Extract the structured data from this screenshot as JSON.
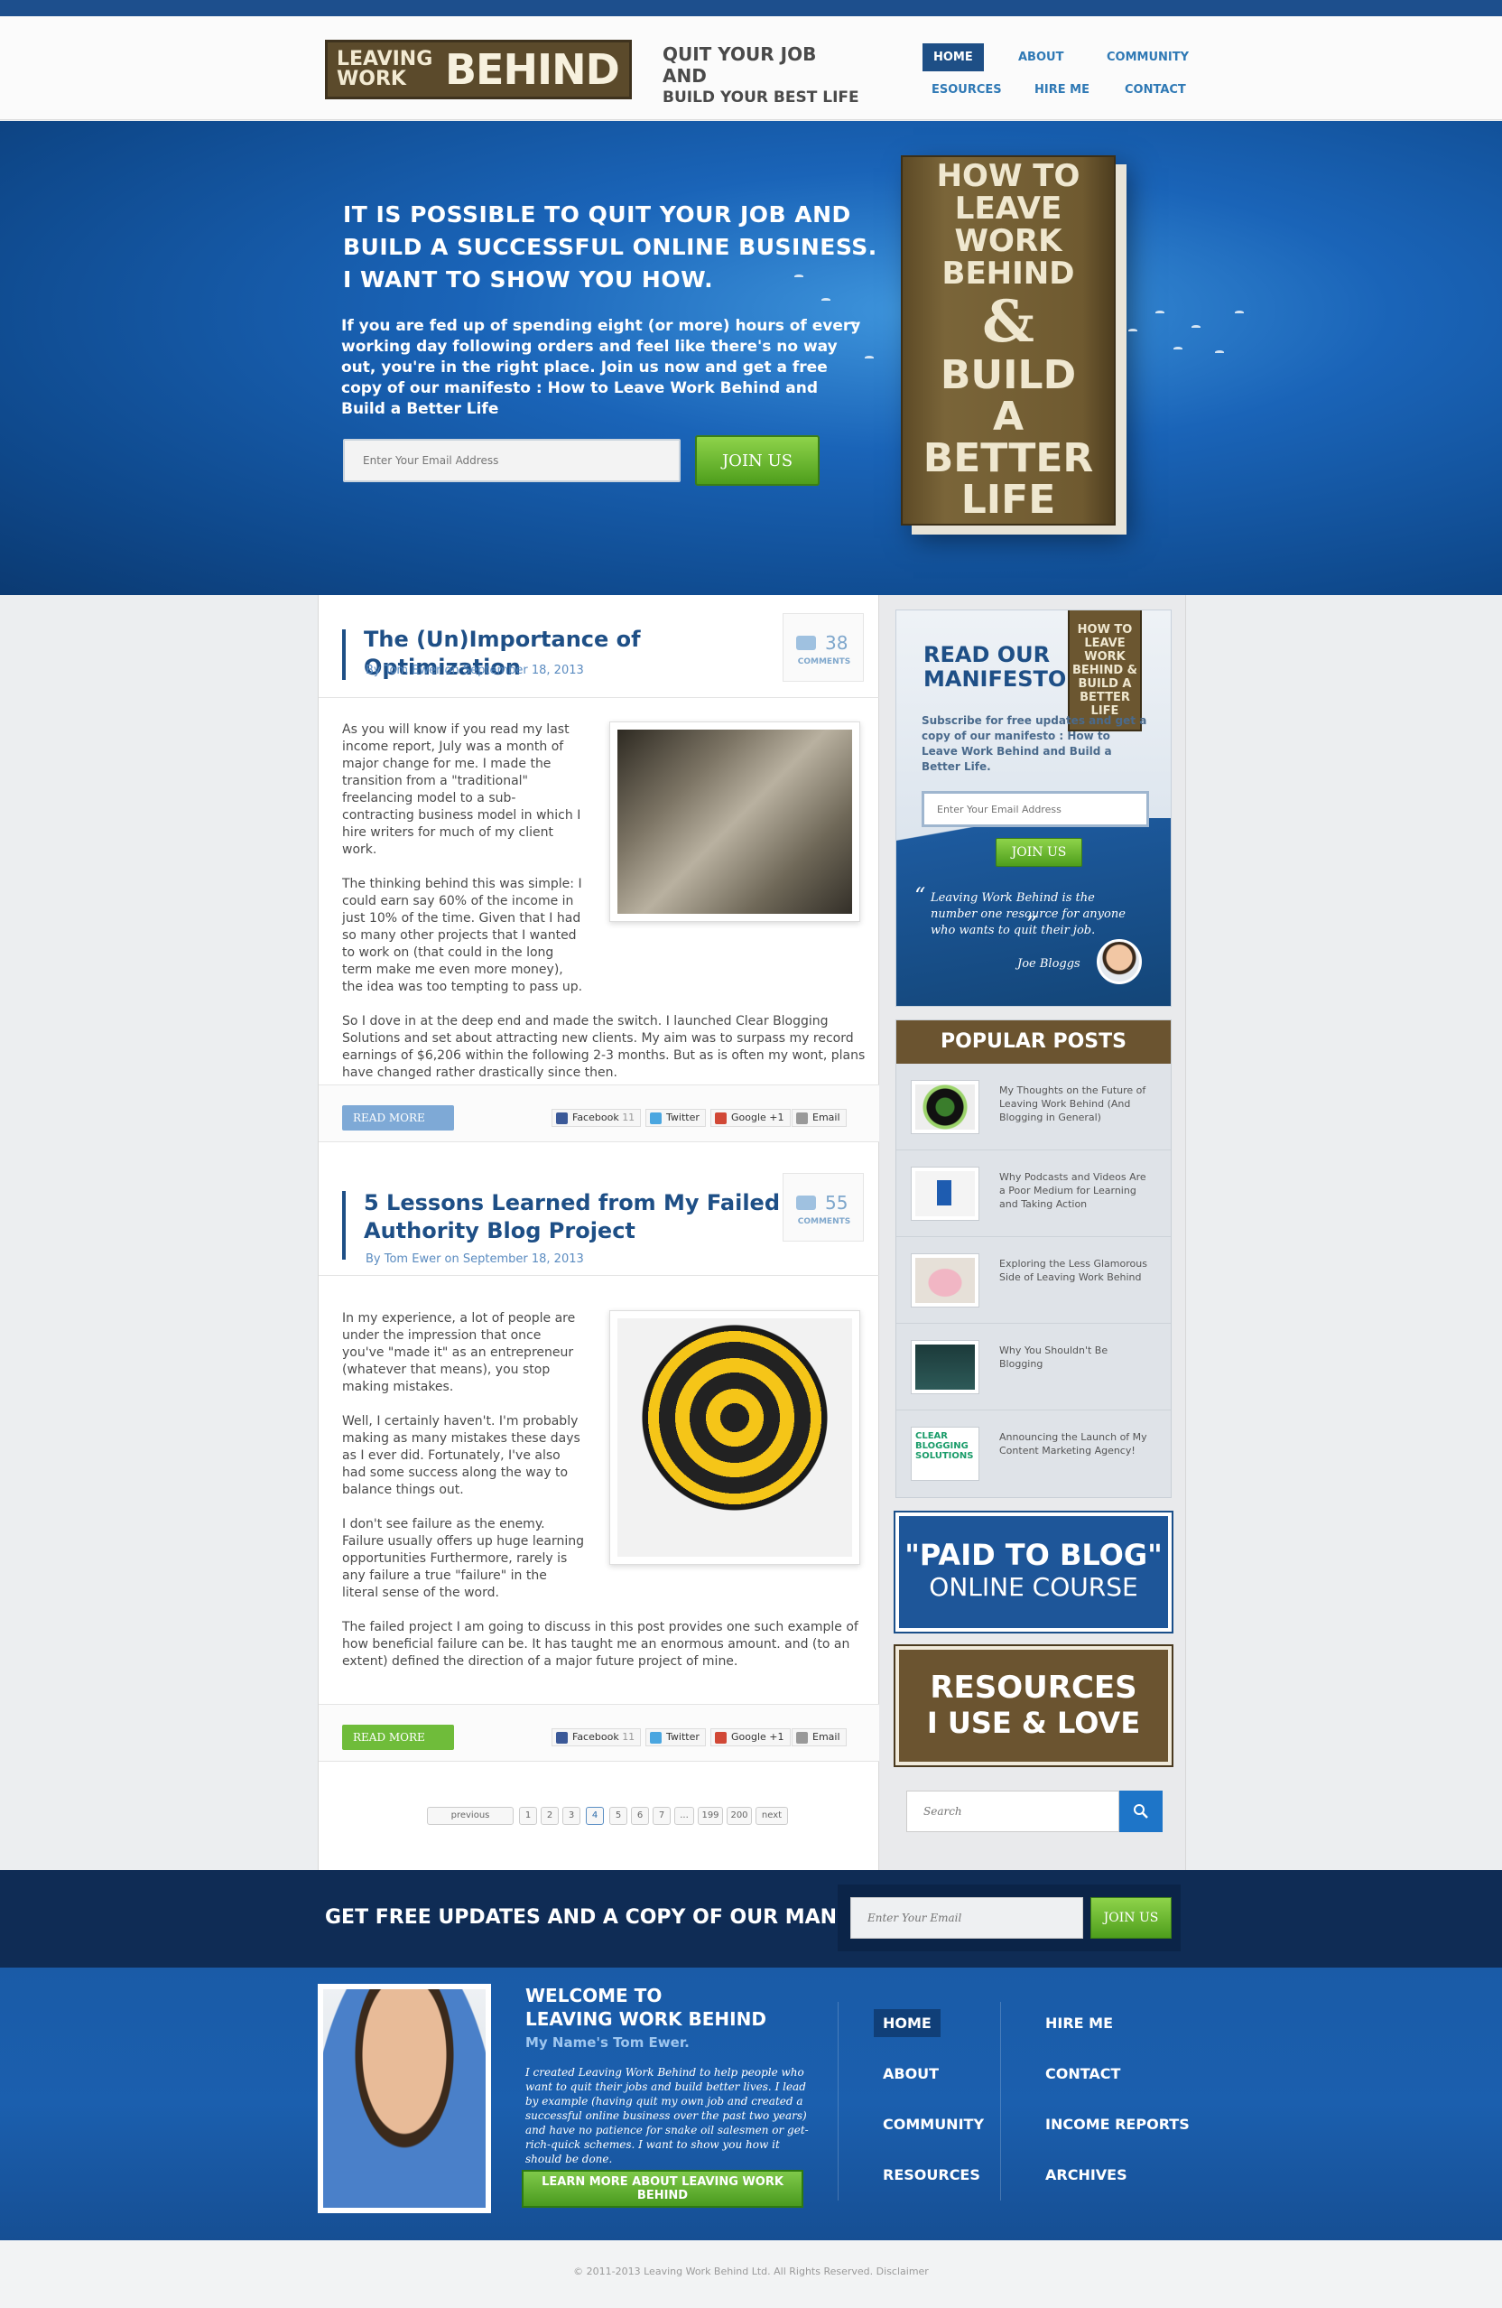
{
  "header": {
    "logo_small": "LEAVING WORK",
    "logo_big": "BEHIND",
    "tagline_l1": "QUIT YOUR JOB AND",
    "tagline_l2": "BUILD YOUR BEST LIFE",
    "nav": [
      "HOME",
      "ABOUT",
      "COMMUNITY",
      "ESOURCES",
      "HIRE ME",
      "CONTACT"
    ]
  },
  "hero": {
    "title_l1": "IT IS POSSIBLE TO QUIT YOUR JOB AND",
    "title_l2": "BUILD A SUCCESSFUL ONLINE BUSINESS.",
    "title_l3": "I WANT TO SHOW YOU HOW.",
    "text": "If you are fed up of spending eight (or more) hours of every working day following orders and feel like there's no way out, you're in the right place. Join us now and get a free copy of our manifesto : How to Leave Work Behind and Build a Better Life",
    "email_placeholder": "Enter Your Email Address",
    "join_label": "JOIN US",
    "book_l1": "HOW TO LEAVE",
    "book_l2": "WORK BEHIND",
    "book_amp": "&",
    "book_l3": "BUILD A",
    "book_l4": "BETTER LIFE"
  },
  "posts": [
    {
      "title": "The (Un)Importance of Optimization",
      "meta": "By Tom Ewer on September 18, 2013",
      "comments": "38",
      "comments_label": "COMMENTS",
      "p1": "As you will know if you read my last income report, July was a month of major change for me. I made the transition from a \"traditional\" freelancing model to a sub-contracting business model in which I hire writers for much of my client work.",
      "p2": "The thinking behind this was simple: I could earn say 60% of the income in just 10% of the time. Given that I had so many other projects that I wanted to work on (that could in the long term make me even more money), the idea was too tempting to pass up.",
      "p3": "So I dove in at the deep end and made the switch. I launched Clear Blogging Solutions and set about attracting new clients. My aim was to surpass my record earnings of $6,206 within the following 2-3 months. But as is often my wont, plans have changed rather drastically since then.",
      "read_more": "READ MORE"
    },
    {
      "title": "5 Lessons Learned from My Failed Authority Blog Project",
      "meta": "By Tom Ewer on September 18, 2013",
      "comments": "55",
      "comments_label": "COMMENTS",
      "p1": "In my experience, a lot of people are under the  impression that once you've \"made it\" as an entrepreneur (whatever that means), you stop making mistakes.",
      "p2": "Well, I certainly haven't. I'm probably making as many mistakes these days as I ever did. Fortunately, I've also had some success along the way to balance things out.",
      "p3": "I don't see failure as the enemy. Failure usually offers up huge learning opportunities Furthermore, rarely is any failure a true \"failure\" in the literal sense of the word.",
      "p4": "The failed project I am going to discuss in this post provides one such example of how beneficial failure can be. It has taught me an enormous amount. and (to an extent) defined the direction of a major future project of mine.",
      "read_more": "READ MORE"
    }
  ],
  "share": {
    "facebook": "Facebook",
    "facebook_count": "11",
    "twitter": "Twitter",
    "google": "Google +1",
    "email": "Email"
  },
  "pagination": [
    "previous",
    "1",
    "2",
    "3",
    "4",
    "5",
    "6",
    "7",
    "...",
    "199",
    "200",
    "next"
  ],
  "sidebar": {
    "manifesto_title_l1": "READ OUR",
    "manifesto_title_l2": "MANIFESTO",
    "manifesto_book": "HOW TO LEAVE WORK BEHIND & BUILD A BETTER LIFE",
    "manifesto_text": "Subscribe for free updates and get a copy of our manifesto : How to Leave Work Behind and Build a Better Life.",
    "email_placeholder": "Enter Your Email Address",
    "join_label": "JOIN US",
    "quote": "Leaving Work Behind  is the number one resource  for anyone who wants to quit their job.",
    "quote_author": "Joe Bloggs",
    "popular_title": "POPULAR POSTS",
    "popular": [
      "My Thoughts on the Future of Leaving Work Behind (And Blogging in General)",
      "Why Podcasts and Videos Are a Poor Medium for Learning and Taking Action",
      "Exploring the Less Glamorous Side of Leaving Work Behind",
      "Why You Shouldn't Be Blogging",
      "Announcing the Launch of My Content Marketing Agency!"
    ],
    "popular_thumb5": "CLEAR BLOGGING SOLUTIONS",
    "paid_l1": "\"PAID TO BLOG\"",
    "paid_l2": "ONLINE COURSE",
    "res_l1": "RESOURCES",
    "res_l2": "I USE & LOVE",
    "search_placeholder": "Search"
  },
  "newsletter": {
    "title": "GET FREE UPDATES AND A COPY OF OUR MANIFESTO",
    "email_placeholder": "Enter Your Email",
    "join_label": "JOIN US"
  },
  "footer": {
    "title_l1": "WELCOME TO",
    "title_l2": "LEAVING WORK BEHIND",
    "subtitle": "My Name's Tom Ewer.",
    "text": "I created Leaving Work Behind to help people who want to quit their jobs and build better lives. I lead by example (having quit my own job and created a successful online business over the past two years) and have no patience for snake oil salesmen or get-rich-quick schemes. I want to show you how it should be done.",
    "button": "LEARN MORE ABOUT LEAVING WORK BEHIND",
    "nav_col1": [
      "HOME",
      "ABOUT",
      "COMMUNITY",
      "RESOURCES"
    ],
    "nav_col2": [
      "HIRE ME",
      "CONTACT",
      "INCOME REPORTS",
      "ARCHIVES"
    ]
  },
  "copyright": "© 2011-2013 Leaving Work Behind Ltd. All Rights Reserved. Disclaimer",
  "colors": {
    "brand_blue": "#1e4f86",
    "brand_brown": "#6b5430",
    "accent_green": "#6fbc3a"
  }
}
